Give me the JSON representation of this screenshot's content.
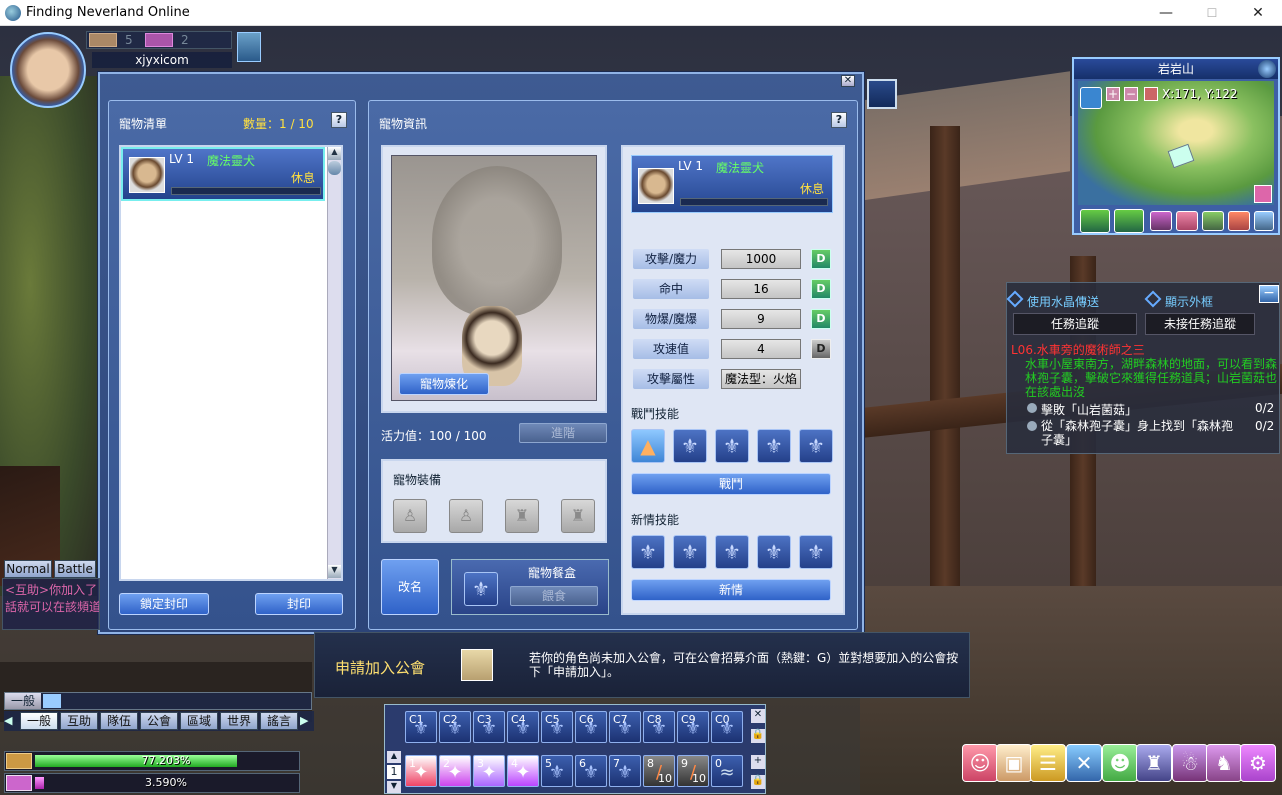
{
  "window": {
    "title": "Finding Neverland Online",
    "minimize": "—",
    "maximize": "☐",
    "close": "✕"
  },
  "player": {
    "name": "xjyxicom",
    "badge1_value": "5",
    "badge2_value": "2"
  },
  "pet_list": {
    "title": "寵物清單",
    "count_label": "數量：1 / 10",
    "help": "?",
    "pet": {
      "level": "LV 1",
      "name": "魔法靈犬",
      "status": "休息"
    },
    "lock_seal_btn": "鎖定封印",
    "seal_btn": "封印"
  },
  "pet_info": {
    "title": "寵物資訊",
    "help": "?",
    "refine_btn": "寵物煉化",
    "vitality_label": "活力值：100 / 100",
    "advance_btn": "進階",
    "equip_title": "寵物裝備",
    "rename_btn": "改名",
    "food_box_title": "寵物餐盒",
    "feed_btn": "餵食",
    "card": {
      "level": "LV 1",
      "name": "魔法靈犬",
      "status": "休息"
    },
    "stats": [
      {
        "label": "攻擊/魔力",
        "value": "1000",
        "btn": "D"
      },
      {
        "label": "命中",
        "value": "16",
        "btn": "D"
      },
      {
        "label": "物爆/魔爆",
        "value": "9",
        "btn": "D"
      },
      {
        "label": "攻速值",
        "value": "4",
        "btn": "D"
      },
      {
        "label": "攻擊屬性",
        "value": "魔法型：火焰"
      }
    ],
    "battle_skills_title": "戰鬥技能",
    "battle_btn": "戰鬥",
    "mood_skills_title": "新情技能",
    "mood_btn": "新情"
  },
  "minimap": {
    "area": "岩岩山",
    "coords": "X:171, Y:122"
  },
  "quest": {
    "crystal_teleport": "使用水晶傳送",
    "show_appearance": "顯示外框",
    "tab_tracking": "任務追蹤",
    "tab_untracked": "未接任務追蹤",
    "quest_title": "L06.水車旁的魔術師之三",
    "desc": "水車小屋東南方，湖畔森林的地面，可以看到森林孢子囊，擊破它來獲得任務道具；山岩菌菇也在該處出沒",
    "objectives": [
      {
        "text": "擊敗「山岩菌菇」",
        "progress": "0/2"
      },
      {
        "text": "從「森林孢子囊」身上找到「森林孢子囊」",
        "progress": "0/2"
      }
    ]
  },
  "guild_notice": {
    "title": "申請加入公會",
    "text": "若你的角色尚未加入公會，可在公會招募介面（熱鍵：G）並對想要加入的公會按下「申請加入」。"
  },
  "chat": {
    "tab_normal": "Normal",
    "tab_battle": "Battle",
    "line1": "<互助>你加入了",
    "line2": "話就可以在該頻道",
    "channel": "一般",
    "channels": [
      "一般",
      "互助",
      "隊伍",
      "公會",
      "區域",
      "世界",
      "謠言"
    ]
  },
  "bars": {
    "exp": "77.203%",
    "sp": "3.590%",
    "exp_fill": 0.77,
    "sp_fill": 0.036
  },
  "hotbar": {
    "row1": [
      "C1",
      "C2",
      "C3",
      "C4",
      "C5",
      "C6",
      "C7",
      "C8",
      "C9",
      "C0"
    ],
    "row2": [
      "1",
      "2",
      "3",
      "4",
      "5",
      "6",
      "7",
      "8",
      "9",
      "0"
    ],
    "page": "1",
    "count8": "10",
    "count9": "10"
  }
}
